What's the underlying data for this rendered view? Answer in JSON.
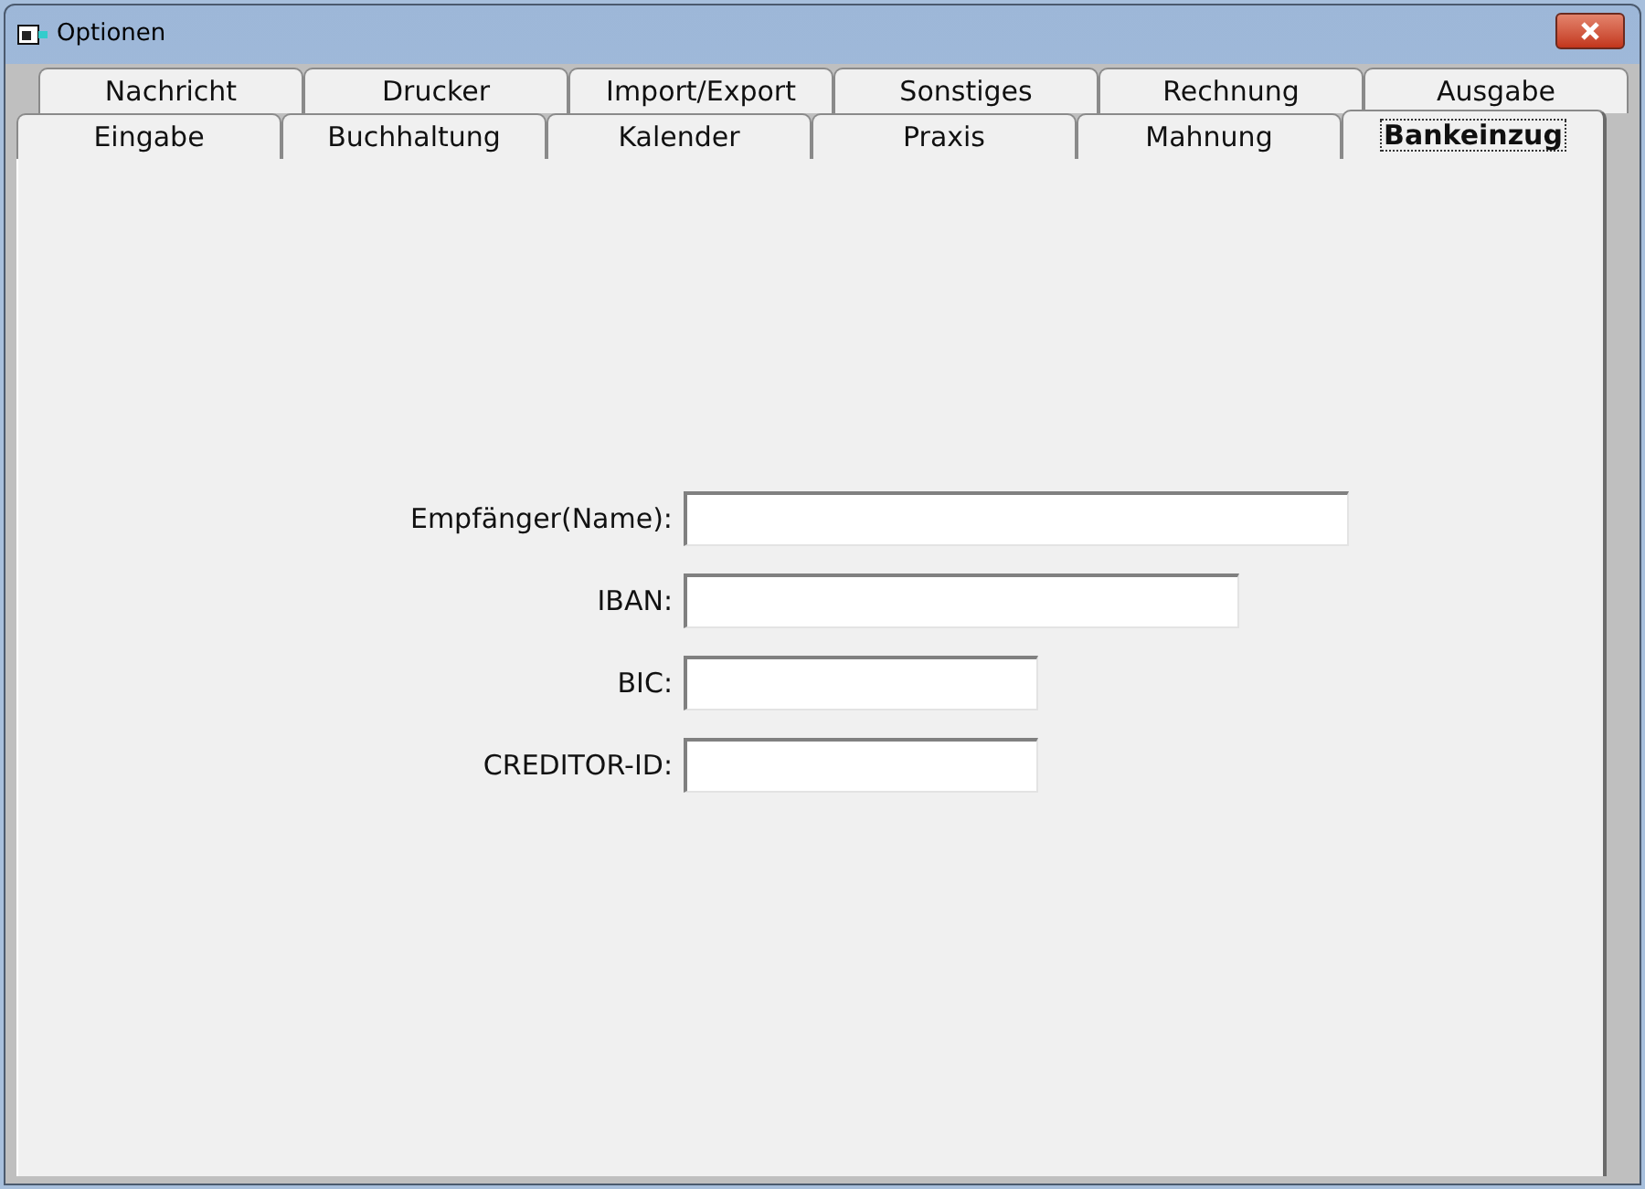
{
  "window": {
    "title": "Optionen"
  },
  "tab_rows": [
    {
      "tabs": [
        {
          "label": "Nachricht",
          "selected": false
        },
        {
          "label": "Drucker",
          "selected": false
        },
        {
          "label": "Import/Export",
          "selected": false
        },
        {
          "label": "Sonstiges",
          "selected": false
        },
        {
          "label": "Rechnung",
          "selected": false
        },
        {
          "label": "Ausgabe",
          "selected": false
        }
      ]
    },
    {
      "tabs": [
        {
          "label": "Eingabe",
          "selected": false
        },
        {
          "label": "Buchhaltung",
          "selected": false
        },
        {
          "label": "Kalender",
          "selected": false
        },
        {
          "label": "Praxis",
          "selected": false
        },
        {
          "label": "Mahnung",
          "selected": false
        },
        {
          "label": "Bankeinzug",
          "selected": true
        }
      ]
    }
  ],
  "fields": [
    {
      "label": "Empfänger(Name):"
    },
    {
      "label": "IBAN:"
    },
    {
      "label": "BIC:"
    },
    {
      "label": "CREDITOR-ID:"
    }
  ]
}
